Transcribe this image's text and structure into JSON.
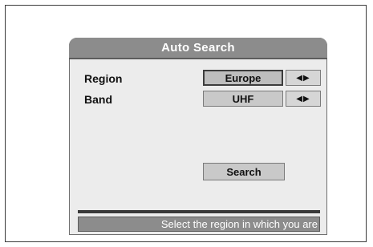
{
  "dialog": {
    "title": "Auto Search",
    "rows": [
      {
        "label": "Region",
        "value": "Europe"
      },
      {
        "label": "Band",
        "value": "UHF"
      }
    ],
    "search_label": "Search",
    "status_text": "Select the region in which you are"
  },
  "icons": {
    "arrows": "left-right-arrows-icon"
  },
  "colors": {
    "title_bar": "#8c8c8c",
    "panel": "#ececec",
    "field": "#c9c9c9",
    "status_bar": "#8c8c8c"
  }
}
